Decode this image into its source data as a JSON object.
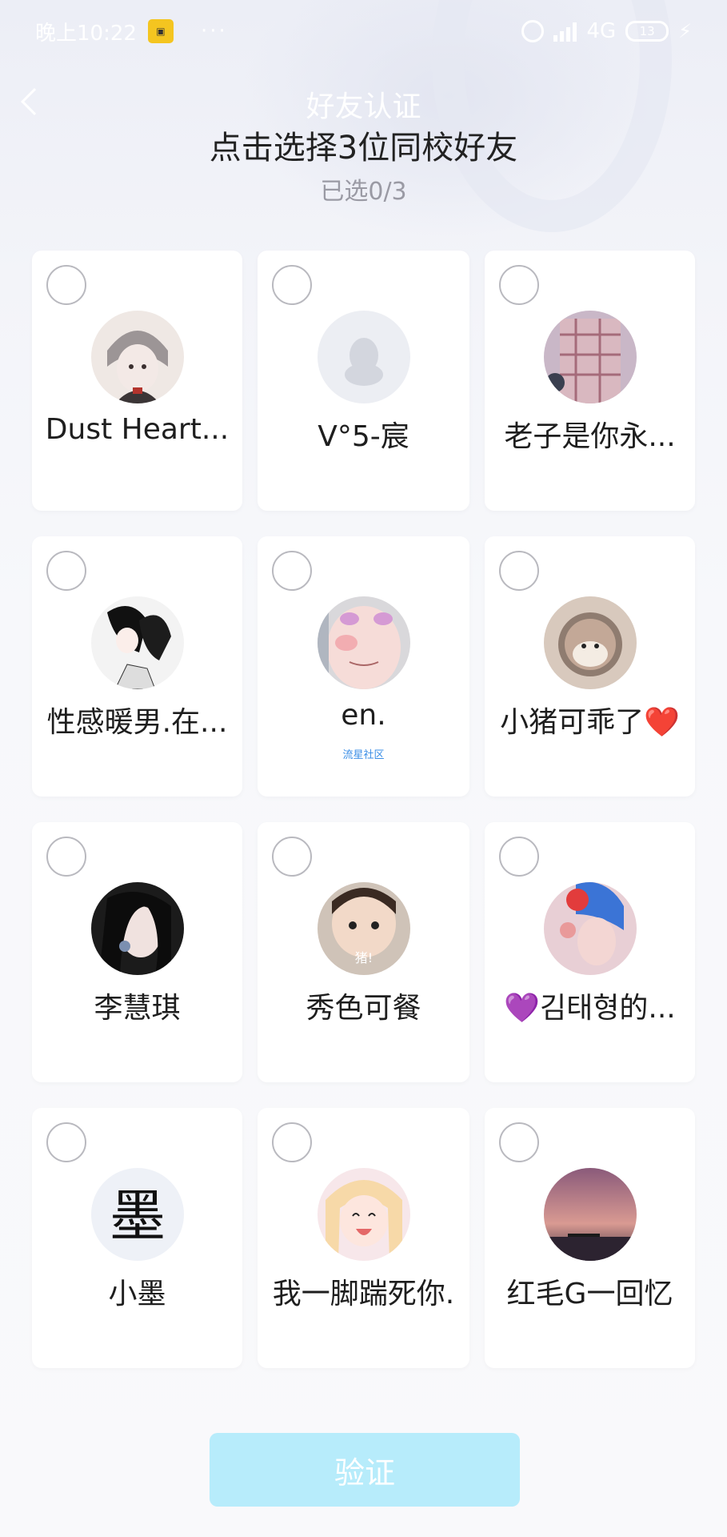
{
  "status_bar": {
    "time": "晚上10:22",
    "dots": "···",
    "network": "4G",
    "battery": "13"
  },
  "header": {
    "nav_title": "好友认证",
    "main_title": "点击选择3位同校好友",
    "selected_count": "已选0/3"
  },
  "friends": [
    {
      "name": "Dust Heart...",
      "tag": ""
    },
    {
      "name": "V°5-宸",
      "tag": ""
    },
    {
      "name": "老子是你永...",
      "tag": ""
    },
    {
      "name": "性感暖男.在...",
      "tag": ""
    },
    {
      "name": "en.",
      "tag": "流星社区"
    },
    {
      "name": "小猪可乖了❤️",
      "tag": ""
    },
    {
      "name": "李慧琪",
      "tag": ""
    },
    {
      "name": "秀色可餐",
      "tag": ""
    },
    {
      "name": "💜김태형的...",
      "tag": ""
    },
    {
      "name": "小墨",
      "tag": ""
    },
    {
      "name": "我一脚踹死你.",
      "tag": ""
    },
    {
      "name": "红毛G一回忆",
      "tag": ""
    }
  ],
  "avatar_text": {
    "f7": "猪!",
    "f9": "墨"
  },
  "footer": {
    "verify_label": "验证"
  },
  "colors": {
    "button_bg": "#b7ecfb",
    "checkbox_border": "#b9b9bf",
    "tag_color": "#3a8ee6"
  }
}
